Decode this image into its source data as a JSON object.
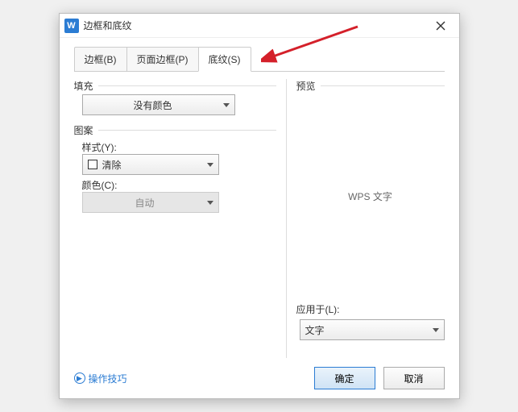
{
  "title": "边框和底纹",
  "tabs": {
    "border": "边框(B)",
    "pageBorder": "页面边框(P)",
    "shading": "底纹(S)"
  },
  "left": {
    "fillLabel": "填充",
    "fillValue": "没有颜色",
    "patternGroup": "图案",
    "styleLabel": "样式(Y):",
    "styleValue": "清除",
    "colorLabel": "颜色(C):",
    "colorValue": "自动"
  },
  "right": {
    "previewLabel": "预览",
    "previewText": "WPS 文字",
    "applyToLabel": "应用于(L):",
    "applyToValue": "文字"
  },
  "footer": {
    "tips": "操作技巧",
    "ok": "确定",
    "cancel": "取消"
  }
}
